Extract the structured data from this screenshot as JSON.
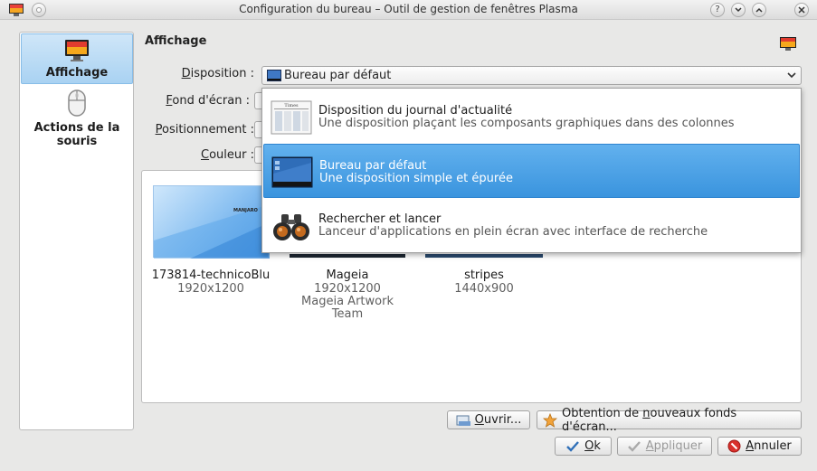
{
  "window": {
    "title": "Configuration du bureau – Outil de gestion de fenêtres Plasma",
    "controls": {
      "help": "?",
      "minimize": "⌄",
      "maximize": "⌃",
      "close": "✕"
    }
  },
  "sidebar": {
    "items": [
      {
        "label": "Affichage",
        "icon": "monitor-icon",
        "selected": true
      },
      {
        "label_line1": "Actions de la",
        "label_line2": "souris",
        "icon": "mouse-icon",
        "selected": false
      }
    ]
  },
  "page": {
    "title": "Affichage"
  },
  "form": {
    "disposition_label": "Disposition :",
    "disposition_label_mn": "D",
    "disposition_label_rest": "isposition :",
    "fond_label_mn": "F",
    "fond_label_rest": "ond d'écran :",
    "positionnement_label_mn": "P",
    "positionnement_label_rest": "ositionnement :",
    "couleur_label_mn": "C",
    "couleur_label_rest": "ouleur :"
  },
  "combo": {
    "value": "Bureau par défaut"
  },
  "dropdown": {
    "options": [
      {
        "title": "Disposition du journal d'actualité",
        "desc": "Une disposition plaçant les composants graphiques dans des colonnes",
        "icon": "newspaper-icon",
        "icon_text": "Times"
      },
      {
        "title": "Bureau par défaut",
        "desc": "Une disposition simple et épurée",
        "icon": "desktop-icon",
        "selected": true
      },
      {
        "title": "Rechercher et lancer",
        "desc": "Lanceur d'applications en plein écran avec interface de recherche",
        "icon": "binoculars-icon"
      }
    ]
  },
  "wallpapers": [
    {
      "name": "173814-technicoBlu",
      "meta1": "1920x1200",
      "thumb_text": "MANJARO"
    },
    {
      "name": "Mageia",
      "meta1": "1920x1200",
      "meta2": "Mageia Artwork",
      "meta3": "Team"
    },
    {
      "name": "stripes",
      "meta1": "1440x900"
    }
  ],
  "buttons": {
    "open_mn": "O",
    "open_rest": "uvrir...",
    "get_new_pre": "Obtention de ",
    "get_new_mn": "n",
    "get_new_rest": "ouveaux fonds d'écran...",
    "ok_mn": "O",
    "ok_rest": "k",
    "apply_mn": "A",
    "apply_rest": "ppliquer",
    "cancel_mn": "A",
    "cancel_rest": "nnuler"
  },
  "colors": {
    "selection": "#3a94de",
    "sidebar_selection": "#a9d2f2",
    "window_bg": "#e8e8e7"
  }
}
